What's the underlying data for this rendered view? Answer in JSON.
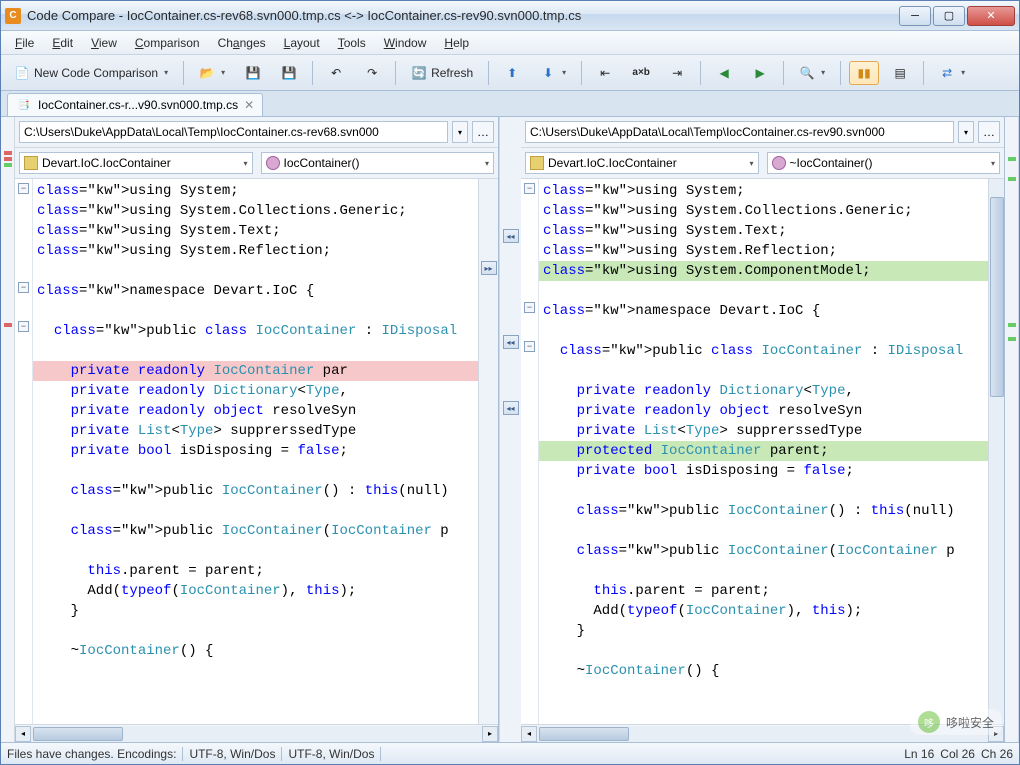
{
  "titlebar": {
    "app_icon_letter": "C",
    "title": "Code Compare - IocContainer.cs-rev68.svn000.tmp.cs <-> IocContainer.cs-rev90.svn000.tmp.cs"
  },
  "menubar": [
    {
      "ul": "F",
      "rest": "ile"
    },
    {
      "ul": "E",
      "rest": "dit"
    },
    {
      "ul": "V",
      "rest": "iew"
    },
    {
      "ul": "C",
      "rest": "omparison"
    },
    {
      "ul": "C",
      "rest": "hanges",
      "full": "Changes",
      "pre": "C",
      "post": "hanges",
      "ulpos": 1
    },
    {
      "ul": "L",
      "rest": "ayout"
    },
    {
      "ul": "T",
      "rest": "ools"
    },
    {
      "ul": "W",
      "rest": "indow"
    },
    {
      "ul": "H",
      "rest": "elp"
    }
  ],
  "toolbar": {
    "new_label": "New Code Comparison",
    "refresh_label": "Refresh"
  },
  "tab": {
    "label": "IocContainer.cs-r...v90.svn000.tmp.cs"
  },
  "left": {
    "path": "C:\\Users\\Duke\\AppData\\Local\\Temp\\IocContainer.cs-rev68.svn000",
    "class_combo": "Devart.IoC.IocContainer",
    "member_combo": "IocContainer()",
    "code": [
      {
        "t": "using System;",
        "hl": ""
      },
      {
        "t": "using System.Collections.Generic;",
        "hl": ""
      },
      {
        "t": "using System.Text;",
        "hl": ""
      },
      {
        "t": "using System.Reflection;",
        "hl": ""
      },
      {
        "t": "",
        "hl": ""
      },
      {
        "t": "namespace Devart.IoC {",
        "hl": ""
      },
      {
        "t": "",
        "hl": ""
      },
      {
        "t": "  public class IocContainer : IDisposal",
        "hl": ""
      },
      {
        "t": "",
        "hl": ""
      },
      {
        "t": "    private readonly IocContainer par",
        "hl": "red"
      },
      {
        "t": "    private readonly Dictionary<Type,",
        "hl": ""
      },
      {
        "t": "    private readonly object resolveSyn",
        "hl": ""
      },
      {
        "t": "    private List<Type> supprerssedType",
        "hl": ""
      },
      {
        "t": "    private bool isDisposing = false;",
        "hl": ""
      },
      {
        "t": "",
        "hl": ""
      },
      {
        "t": "    public IocContainer() : this(null)",
        "hl": ""
      },
      {
        "t": "",
        "hl": ""
      },
      {
        "t": "    public IocContainer(IocContainer p",
        "hl": ""
      },
      {
        "t": "",
        "hl": ""
      },
      {
        "t": "      this.parent = parent;",
        "hl": ""
      },
      {
        "t": "      Add(typeof(IocContainer), this);",
        "hl": ""
      },
      {
        "t": "    }",
        "hl": ""
      },
      {
        "t": "",
        "hl": ""
      },
      {
        "t": "    ~IocContainer() {",
        "hl": ""
      }
    ]
  },
  "right": {
    "path": "C:\\Users\\Duke\\AppData\\Local\\Temp\\IocContainer.cs-rev90.svn000",
    "class_combo": "Devart.IoC.IocContainer",
    "member_combo": "~IocContainer()",
    "code": [
      {
        "t": "using System;",
        "hl": ""
      },
      {
        "t": "using System.Collections.Generic;",
        "hl": ""
      },
      {
        "t": "using System.Text;",
        "hl": ""
      },
      {
        "t": "using System.Reflection;",
        "hl": ""
      },
      {
        "t": "using System.ComponentModel;",
        "hl": "green"
      },
      {
        "t": "",
        "hl": ""
      },
      {
        "t": "namespace Devart.IoC {",
        "hl": ""
      },
      {
        "t": "",
        "hl": ""
      },
      {
        "t": "  public class IocContainer : IDisposal",
        "hl": ""
      },
      {
        "t": "",
        "hl": ""
      },
      {
        "t": "    private readonly Dictionary<Type,",
        "hl": ""
      },
      {
        "t": "    private readonly object resolveSyn",
        "hl": ""
      },
      {
        "t": "    private List<Type> supprerssedType",
        "hl": ""
      },
      {
        "t": "    protected IocContainer parent;",
        "hl": "green"
      },
      {
        "t": "    private bool isDisposing = false;",
        "hl": ""
      },
      {
        "t": "",
        "hl": ""
      },
      {
        "t": "    public IocContainer() : this(null)",
        "hl": ""
      },
      {
        "t": "",
        "hl": ""
      },
      {
        "t": "    public IocContainer(IocContainer p",
        "hl": ""
      },
      {
        "t": "",
        "hl": ""
      },
      {
        "t": "      this.parent = parent;",
        "hl": ""
      },
      {
        "t": "      Add(typeof(IocContainer), this);",
        "hl": ""
      },
      {
        "t": "    }",
        "hl": ""
      },
      {
        "t": "",
        "hl": ""
      },
      {
        "t": "    ~IocContainer() {",
        "hl": ""
      }
    ]
  },
  "status": {
    "changes": "Files have changes. Encodings:",
    "enc1": "UTF-8, Win/Dos",
    "enc2": "UTF-8, Win/Dos",
    "ln": "Ln 16",
    "col": "Col 26",
    "ch": "Ch 26"
  },
  "watermark": "哆啦安全"
}
